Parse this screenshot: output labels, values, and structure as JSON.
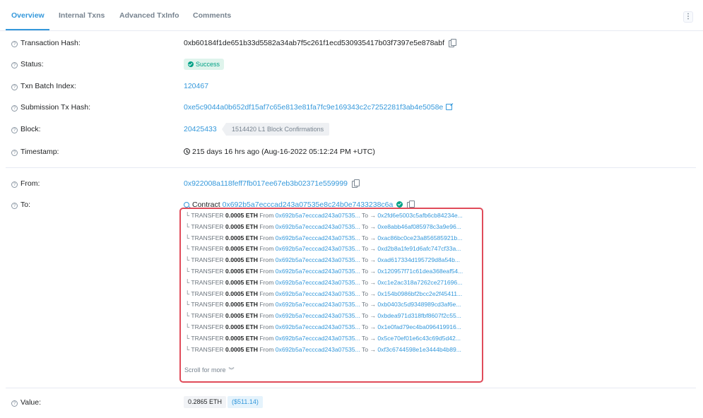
{
  "tabs": [
    {
      "label": "Overview",
      "active": true
    },
    {
      "label": "Internal Txns",
      "active": false
    },
    {
      "label": "Advanced TxInfo",
      "active": false
    },
    {
      "label": "Comments",
      "active": false
    }
  ],
  "menu_icon": "kebab-icon",
  "fields": {
    "tx_hash": {
      "label": "Transaction Hash:",
      "value": "0xb60184f1de651b33d5582a34ab7f5c261f1ecd530935417b03f7397e5e878abf"
    },
    "status": {
      "label": "Status:",
      "value": "Success"
    },
    "batch_index": {
      "label": "Txn Batch Index:",
      "value": "120467"
    },
    "submission_hash": {
      "label": "Submission Tx Hash:",
      "value": "0xe5c9044a0b652df15af7c65e813e81fa7fc9e169343c2c7252281f3ab4e5058e"
    },
    "block": {
      "label": "Block:",
      "value": "20425433",
      "confirmations": "1514420 L1 Block Confirmations"
    },
    "timestamp": {
      "label": "Timestamp:",
      "value": "215 days 16 hrs ago (Aug-16-2022 05:12:24 PM +UTC)"
    },
    "from": {
      "label": "From:",
      "value": "0x922008a118feff7fb017ee67eb3b02371e559999"
    },
    "to": {
      "label": "To:",
      "prefix": "Contract",
      "value": "0x692b5a7ecccad243a07535e8c24b0e7433238c6a"
    },
    "value": {
      "label": "Value:",
      "eth": "0.2865 ETH",
      "usd": "($511.14)"
    }
  },
  "transfer_common": {
    "prefix": "TRANSFER",
    "amount": "0.0005 ETH",
    "from_label": "From",
    "from_addr": "0x692b5a7ecccad243a07535...",
    "to_label": "To"
  },
  "transfers": [
    {
      "to": "0x2fd6e5003c5afb6cb84234e..."
    },
    {
      "to": "0xe8abb46af085978c3a9e96..."
    },
    {
      "to": "0xac86bc0ce23a856585921b..."
    },
    {
      "to": "0xd2b8a1fe91d6afc747cf33a..."
    },
    {
      "to": "0xad617334d195729d8a54b..."
    },
    {
      "to": "0x120957f71c61dea368eaf54..."
    },
    {
      "to": "0xc1e2ac318a7262ce271696..."
    },
    {
      "to": "0x154b0986bf2bcc2e2f45411..."
    },
    {
      "to": "0xb0403c5d9348989cd3af6e..."
    },
    {
      "to": "0xbdea971d318fbf8607f2c55..."
    },
    {
      "to": "0x1e0fad79ec4ba096419916..."
    },
    {
      "to": "0x5ce70ef01e6c43c69d5d42..."
    },
    {
      "to": "0xf3c6744598e1e3444b4b89..."
    }
  ],
  "scroll_more": "Scroll for more",
  "colors": {
    "accent": "#3498db",
    "success": "#00a186",
    "highlight_border": "#e04b5a"
  }
}
